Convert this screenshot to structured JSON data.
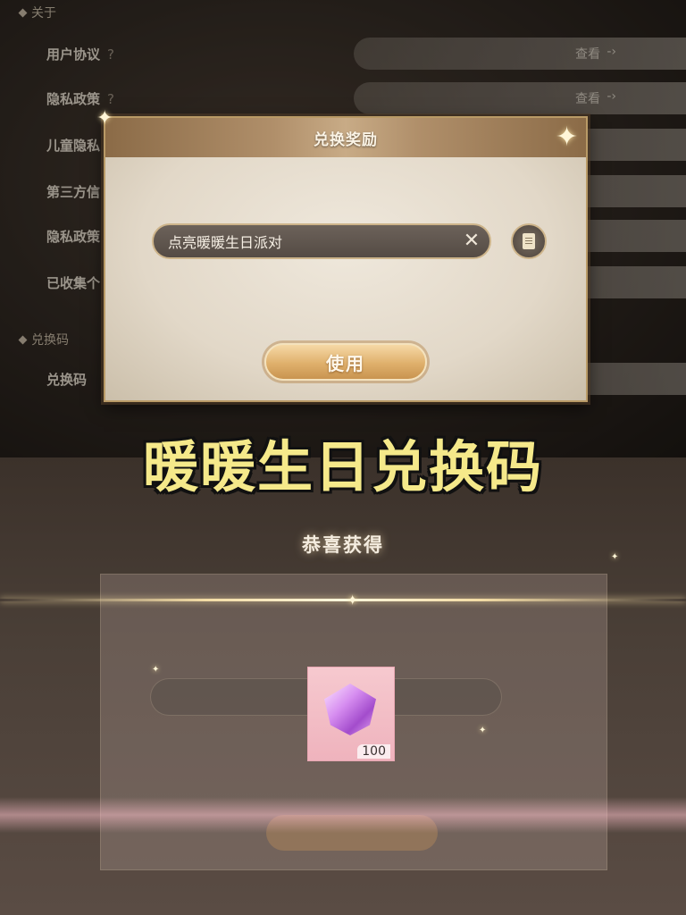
{
  "settings": {
    "section_about": "关于",
    "section_redeem": "兑换码",
    "rows": [
      {
        "label": "用户协议",
        "has_help": true,
        "action": "查看"
      },
      {
        "label": "隐私政策",
        "has_help": true,
        "action": "查看"
      },
      {
        "label": "儿童隐私",
        "has_help": false,
        "action": ""
      },
      {
        "label": "第三方信",
        "has_help": false,
        "action": ""
      },
      {
        "label": "隐私政策",
        "has_help": false,
        "action": ""
      },
      {
        "label": "已收集个",
        "has_help": false,
        "action": ""
      }
    ],
    "redeem_row_label": "兑换码",
    "help_glyph": "?",
    "arrow_glyph": "-›"
  },
  "dialog": {
    "title": "兑换奖励",
    "code_value": "点亮暖暖生日派对",
    "clear_icon": "close-icon",
    "paste_icon": "document-icon",
    "use_label": "使用"
  },
  "caption": "暖暖生日兑换码",
  "reward": {
    "congrats": "恭喜获得",
    "item_icon": "diamond-gem-icon",
    "count": "100"
  },
  "colors": {
    "accent_gold": "#dfb06c",
    "caption_yellow": "#f5e98a",
    "reward_pink": "#f6c9cf"
  }
}
